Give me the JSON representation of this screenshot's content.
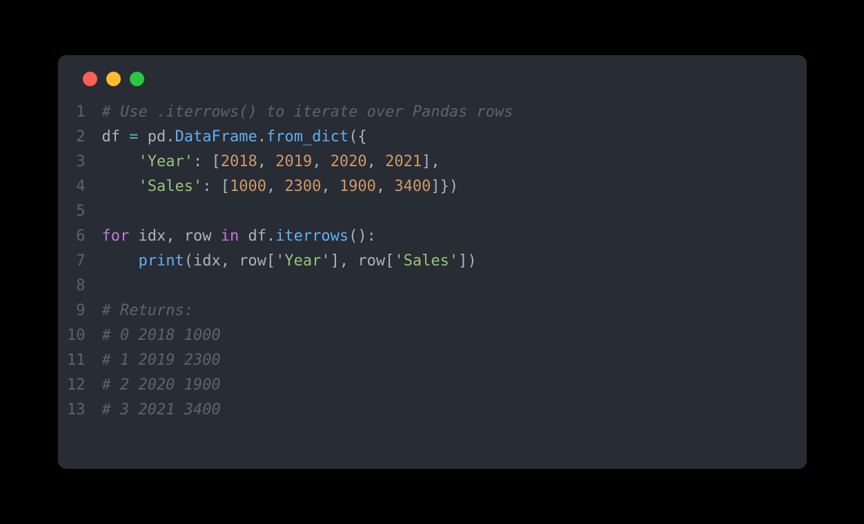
{
  "code": {
    "lines": [
      {
        "num": "1",
        "tokens": [
          {
            "cls": "tok-comment",
            "text": "# Use .iterrows() to iterate over Pandas rows"
          }
        ]
      },
      {
        "num": "2",
        "tokens": [
          {
            "cls": "tok-default",
            "text": "df "
          },
          {
            "cls": "tok-operator",
            "text": "="
          },
          {
            "cls": "tok-default",
            "text": " pd"
          },
          {
            "cls": "tok-default",
            "text": "."
          },
          {
            "cls": "tok-function",
            "text": "DataFrame"
          },
          {
            "cls": "tok-default",
            "text": "."
          },
          {
            "cls": "tok-function",
            "text": "from_dict"
          },
          {
            "cls": "tok-paren",
            "text": "({"
          }
        ]
      },
      {
        "num": "3",
        "tokens": [
          {
            "cls": "tok-default",
            "text": "    "
          },
          {
            "cls": "tok-string",
            "text": "'Year'"
          },
          {
            "cls": "tok-default",
            "text": ": ["
          },
          {
            "cls": "tok-number",
            "text": "2018"
          },
          {
            "cls": "tok-default",
            "text": ", "
          },
          {
            "cls": "tok-number",
            "text": "2019"
          },
          {
            "cls": "tok-default",
            "text": ", "
          },
          {
            "cls": "tok-number",
            "text": "2020"
          },
          {
            "cls": "tok-default",
            "text": ", "
          },
          {
            "cls": "tok-number",
            "text": "2021"
          },
          {
            "cls": "tok-default",
            "text": "],"
          }
        ]
      },
      {
        "num": "4",
        "tokens": [
          {
            "cls": "tok-default",
            "text": "    "
          },
          {
            "cls": "tok-string",
            "text": "'Sales'"
          },
          {
            "cls": "tok-default",
            "text": ": ["
          },
          {
            "cls": "tok-number",
            "text": "1000"
          },
          {
            "cls": "tok-default",
            "text": ", "
          },
          {
            "cls": "tok-number",
            "text": "2300"
          },
          {
            "cls": "tok-default",
            "text": ", "
          },
          {
            "cls": "tok-number",
            "text": "1900"
          },
          {
            "cls": "tok-default",
            "text": ", "
          },
          {
            "cls": "tok-number",
            "text": "3400"
          },
          {
            "cls": "tok-default",
            "text": "]})"
          }
        ]
      },
      {
        "num": "5",
        "tokens": []
      },
      {
        "num": "6",
        "tokens": [
          {
            "cls": "tok-keyword",
            "text": "for"
          },
          {
            "cls": "tok-default",
            "text": " idx, row "
          },
          {
            "cls": "tok-keyword",
            "text": "in"
          },
          {
            "cls": "tok-default",
            "text": " df."
          },
          {
            "cls": "tok-function",
            "text": "iterrows"
          },
          {
            "cls": "tok-default",
            "text": "():"
          }
        ]
      },
      {
        "num": "7",
        "tokens": [
          {
            "cls": "tok-default",
            "text": "    "
          },
          {
            "cls": "tok-function",
            "text": "print"
          },
          {
            "cls": "tok-default",
            "text": "(idx, row["
          },
          {
            "cls": "tok-string",
            "text": "'Year'"
          },
          {
            "cls": "tok-default",
            "text": "], row["
          },
          {
            "cls": "tok-string",
            "text": "'Sales'"
          },
          {
            "cls": "tok-default",
            "text": "])"
          }
        ]
      },
      {
        "num": "8",
        "tokens": []
      },
      {
        "num": "9",
        "tokens": [
          {
            "cls": "tok-comment",
            "text": "# Returns:"
          }
        ]
      },
      {
        "num": "10",
        "tokens": [
          {
            "cls": "tok-comment",
            "text": "# 0 2018 1000"
          }
        ]
      },
      {
        "num": "11",
        "tokens": [
          {
            "cls": "tok-comment",
            "text": "# 1 2019 2300"
          }
        ]
      },
      {
        "num": "12",
        "tokens": [
          {
            "cls": "tok-comment",
            "text": "# 2 2020 1900"
          }
        ]
      },
      {
        "num": "13",
        "tokens": [
          {
            "cls": "tok-comment",
            "text": "# 3 2021 3400"
          }
        ]
      }
    ]
  }
}
